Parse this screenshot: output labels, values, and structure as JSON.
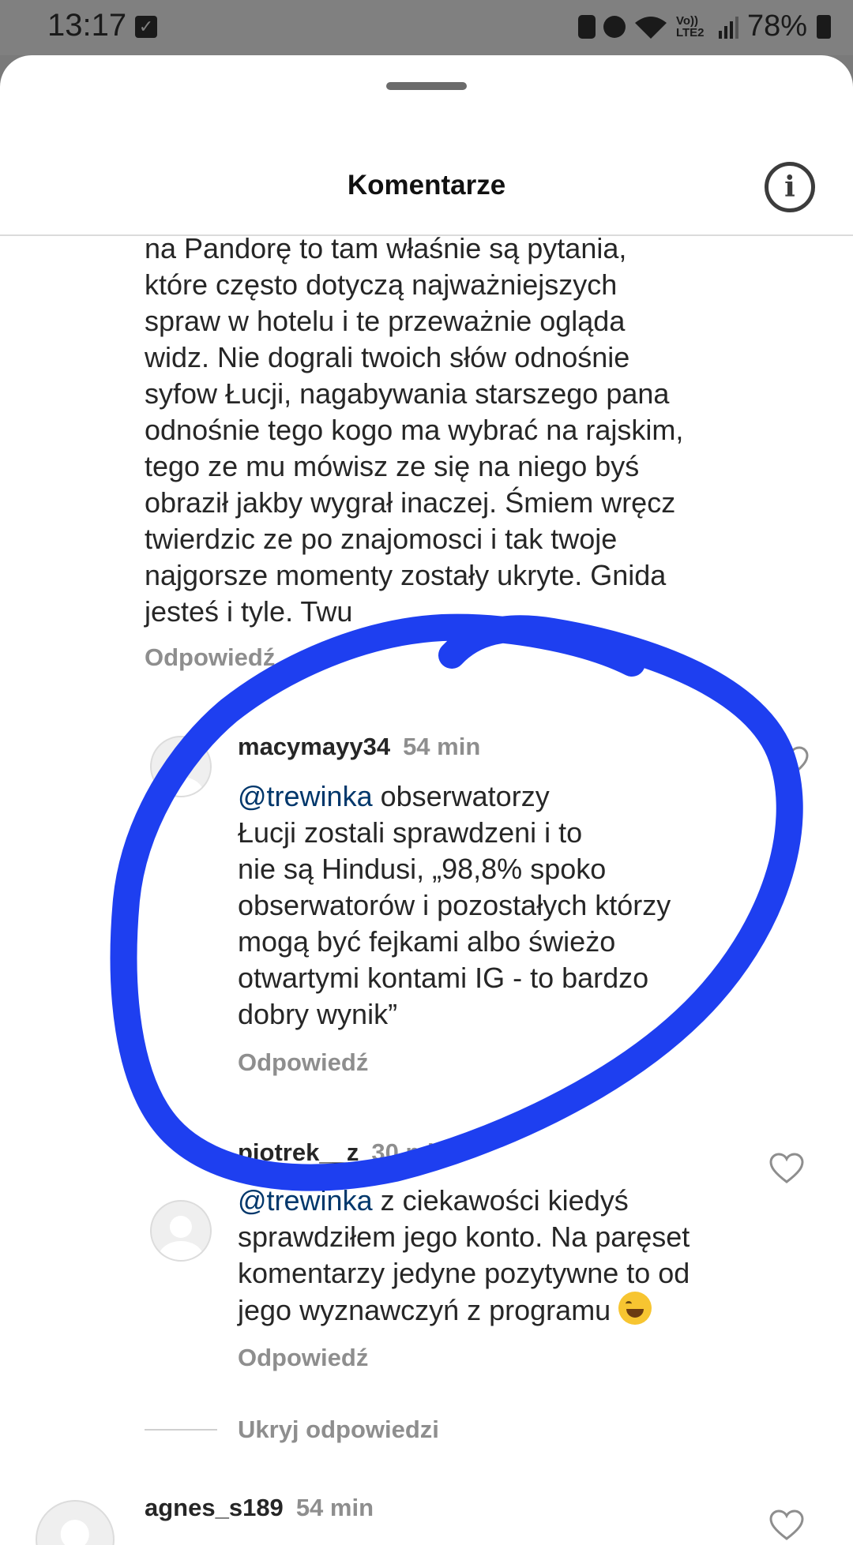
{
  "status_bar": {
    "time": "13:17",
    "signal_text": "Vo)) LTE2",
    "battery": "78%"
  },
  "header": {
    "title": "Komentarze",
    "info_icon": "info-icon"
  },
  "comments": [
    {
      "text": "na Pandorę to tam właśnie są pytania,\nktóre często dotyczą najważniejszych\nspraw w hotelu i te przeważnie ogląda\nwidz. Nie dograli twoich słów odnośnie\nsyfow Łucji, nagabywania starszego pana\nodnośnie tego kogo ma wybrać na rajskim,\ntego ze mu mówisz ze się na niego byś\nobraził jakby wygrał inaczej. Śmiem wręcz\ntwierdzic ze po znajomosci i tak twoje\nnajgorsze momenty zostały ukryte. Gnida\njesteś i tyle. Twu",
      "reply": "Odpowiedź"
    },
    {
      "username": "macymayy34",
      "time": "54 min",
      "mention": "@trewinka",
      "text": " obserwatorzy\nŁucji zostali sprawdzeni i to\nnie są Hindusi, „98,8% spoko\nobserwatorów i pozostałych którzy\nmogą być fejkami albo świeżo\notwartymi kontami IG - to bardzo\ndobry wynik”",
      "reply": "Odpowiedź"
    },
    {
      "username": "piotrek__z",
      "time": "30 min",
      "mention": "@trewinka",
      "text": " z ciekawości kiedyś\nsprawdziłem jego konto. Na paręset\nkomentarzy jedyne pozytywne to od\njego wyznawczyń z programu ",
      "emoji": "laughing-tears-emoji",
      "reply": "Odpowiedź"
    },
    {
      "username": "agnes_s189",
      "time": "54 min"
    }
  ],
  "hide_replies": "Ukryj odpowiedzi",
  "colors": {
    "scribble": "#1e3ff0",
    "mention": "#00376b",
    "secondary_text": "#8e8e8e"
  }
}
